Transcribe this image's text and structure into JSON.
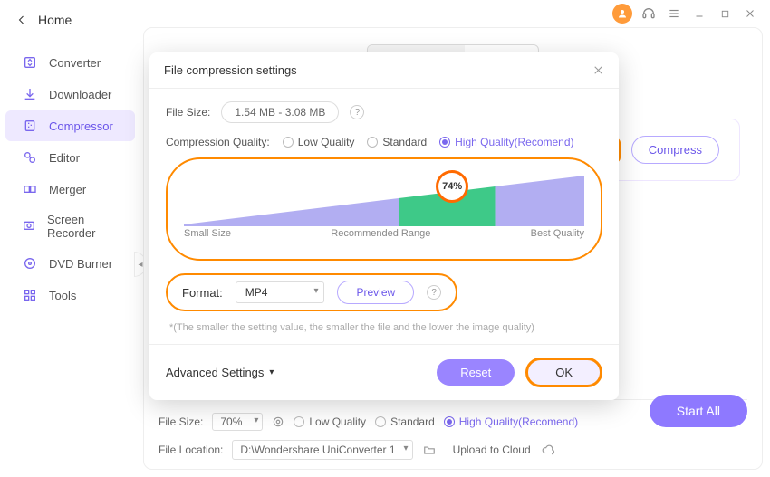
{
  "titlebar": {
    "support_icon": "headset",
    "menu_icon": "menu"
  },
  "home_label": "Home",
  "sidebar": {
    "items": [
      {
        "label": "Converter"
      },
      {
        "label": "Downloader"
      },
      {
        "label": "Compressor"
      },
      {
        "label": "Editor"
      },
      {
        "label": "Merger"
      },
      {
        "label": "Screen Recorder"
      },
      {
        "label": "DVD Burner"
      },
      {
        "label": "Tools"
      }
    ],
    "active_index": 2
  },
  "main": {
    "tabs": {
      "compressing": "Compressing",
      "finished": "Finished"
    },
    "compress_button": "Compress"
  },
  "modal": {
    "title": "File compression settings",
    "file_size_label": "File Size:",
    "file_size_value": "1.54 MB - 3.08 MB",
    "quality_label": "Compression Quality:",
    "quality_options": {
      "low": "Low Quality",
      "standard": "Standard",
      "high": "High Quality(Recomend)"
    },
    "slider": {
      "percent": "74%",
      "small": "Small Size",
      "recommended": "Recommended Range",
      "best": "Best Quality"
    },
    "format_label": "Format:",
    "format_value": "MP4",
    "preview": "Preview",
    "hint": "*(The smaller the setting value, the smaller the file and the lower the image quality)",
    "advanced": "Advanced Settings",
    "reset": "Reset",
    "ok": "OK"
  },
  "bottom": {
    "file_size_label": "File Size:",
    "file_size_value": "70%",
    "low": "Low Quality",
    "standard": "Standard",
    "high": "High Quality(Recomend)",
    "location_label": "File Location:",
    "location_value": "D:\\Wondershare UniConverter 1",
    "upload_label": "Upload to Cloud",
    "start_all": "Start All"
  }
}
